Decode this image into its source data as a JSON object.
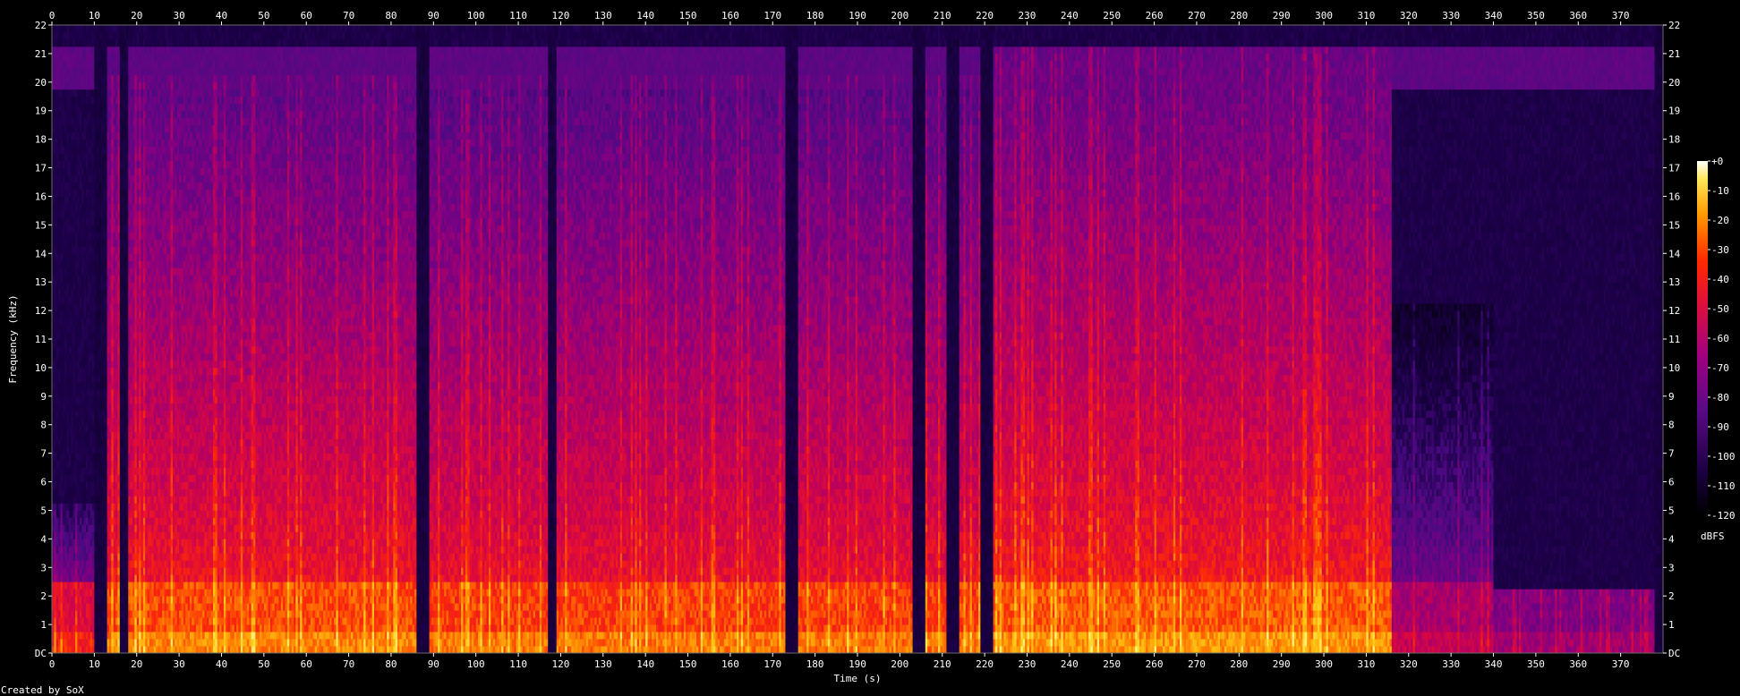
{
  "chart_data": {
    "type": "heatmap",
    "xlabel": "Time (s)",
    "ylabel": "Frequency (kHz)",
    "credit": "Created by SoX",
    "x_ticks": [
      "0",
      "10",
      "20",
      "30",
      "40",
      "50",
      "60",
      "70",
      "80",
      "90",
      "100",
      "110",
      "120",
      "130",
      "140",
      "150",
      "160",
      "170",
      "180",
      "190",
      "200",
      "210",
      "220",
      "230",
      "240",
      "250",
      "260",
      "270",
      "280",
      "290",
      "300",
      "310",
      "320",
      "330",
      "340",
      "350",
      "360",
      "370"
    ],
    "y_ticks": [
      "DC",
      "1",
      "2",
      "3",
      "4",
      "5",
      "6",
      "7",
      "8",
      "9",
      "10",
      "11",
      "12",
      "13",
      "14",
      "15",
      "16",
      "17",
      "18",
      "19",
      "20",
      "21",
      "22"
    ],
    "xlim": [
      0,
      380
    ],
    "ylim": [
      0,
      22
    ],
    "colorbar": {
      "ticks": [
        "+0",
        "-10",
        "-20",
        "-30",
        "-40",
        "-50",
        "-60",
        "-70",
        "-80",
        "-90",
        "-100",
        "-110",
        "-120"
      ],
      "unit": "dBFS",
      "range": [
        -120,
        0
      ]
    },
    "silent_gaps_s": [
      [
        10,
        12
      ],
      [
        16,
        18
      ],
      [
        86,
        89
      ],
      [
        117,
        119
      ],
      [
        173,
        176
      ],
      [
        203,
        206
      ],
      [
        211,
        214
      ],
      [
        219,
        222
      ]
    ],
    "sections": [
      {
        "t": [
          0,
          10
        ],
        "level_db": -55,
        "bandwidth_khz": 5
      },
      {
        "t": [
          13,
          86
        ],
        "level_db": -40,
        "bandwidth_khz": 20
      },
      {
        "t": [
          89,
          173
        ],
        "level_db": -42,
        "bandwidth_khz": 20
      },
      {
        "t": [
          176,
          219
        ],
        "level_db": -42,
        "bandwidth_khz": 20
      },
      {
        "t": [
          222,
          316
        ],
        "level_db": -38,
        "bandwidth_khz": 21
      },
      {
        "t": [
          316,
          340
        ],
        "level_db": -70,
        "bandwidth_khz": 12
      },
      {
        "t": [
          340,
          378
        ],
        "level_db": -80,
        "bandwidth_khz": 2
      }
    ]
  }
}
